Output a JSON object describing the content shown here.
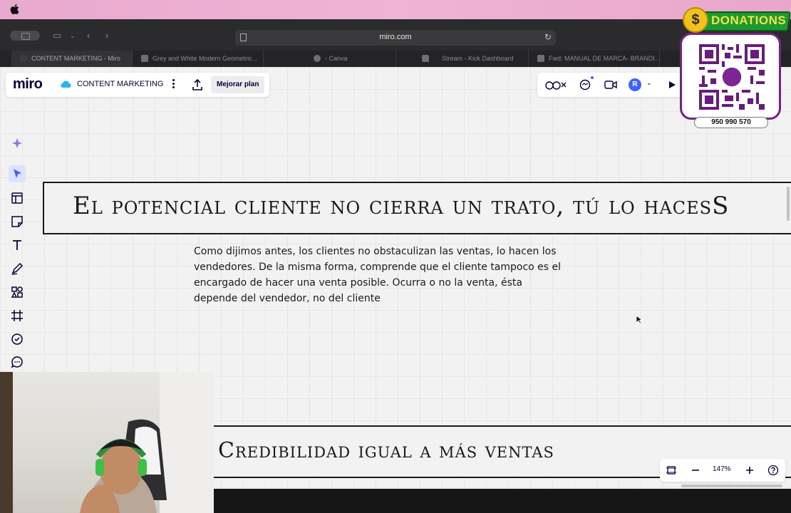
{
  "browser": {
    "url": "miro.com",
    "tabs": [
      {
        "label": "CONTENT MARKETING - Miro",
        "active": true
      },
      {
        "label": "Grey and White Modern Geometric...",
        "active": false
      },
      {
        "label": "- Canva",
        "active": false
      },
      {
        "label": "Stream - Kick Dashboard",
        "active": false
      },
      {
        "label": "Fwd: MANUAL DE MARCA- BRANDI...",
        "active": false
      }
    ]
  },
  "miro": {
    "logo": "miro",
    "board_title": "CONTENT MARKETING",
    "upgrade_label": "Mejorar plan",
    "avatar_initial": "R",
    "zoom": "147%",
    "accent": "#4262ff"
  },
  "board": {
    "heading1": "El potencial cliente no cierra un trato, tú lo hacesS",
    "body": "Como dijimos antes, los clientes no obstaculizan las ventas, lo hacen los vendedores. De la misma forma, comprende que el cliente tampoco es el encargado de hacer una venta posible. Ocurra o no la venta, ésta depende del vendedor, no del cliente",
    "heading2": "Credibilidad igual a más ventas"
  },
  "overlay": {
    "donations_label": "DONATIONS",
    "coin_symbol": "$",
    "qr_brand": "yape",
    "phone": "950 990 570"
  }
}
